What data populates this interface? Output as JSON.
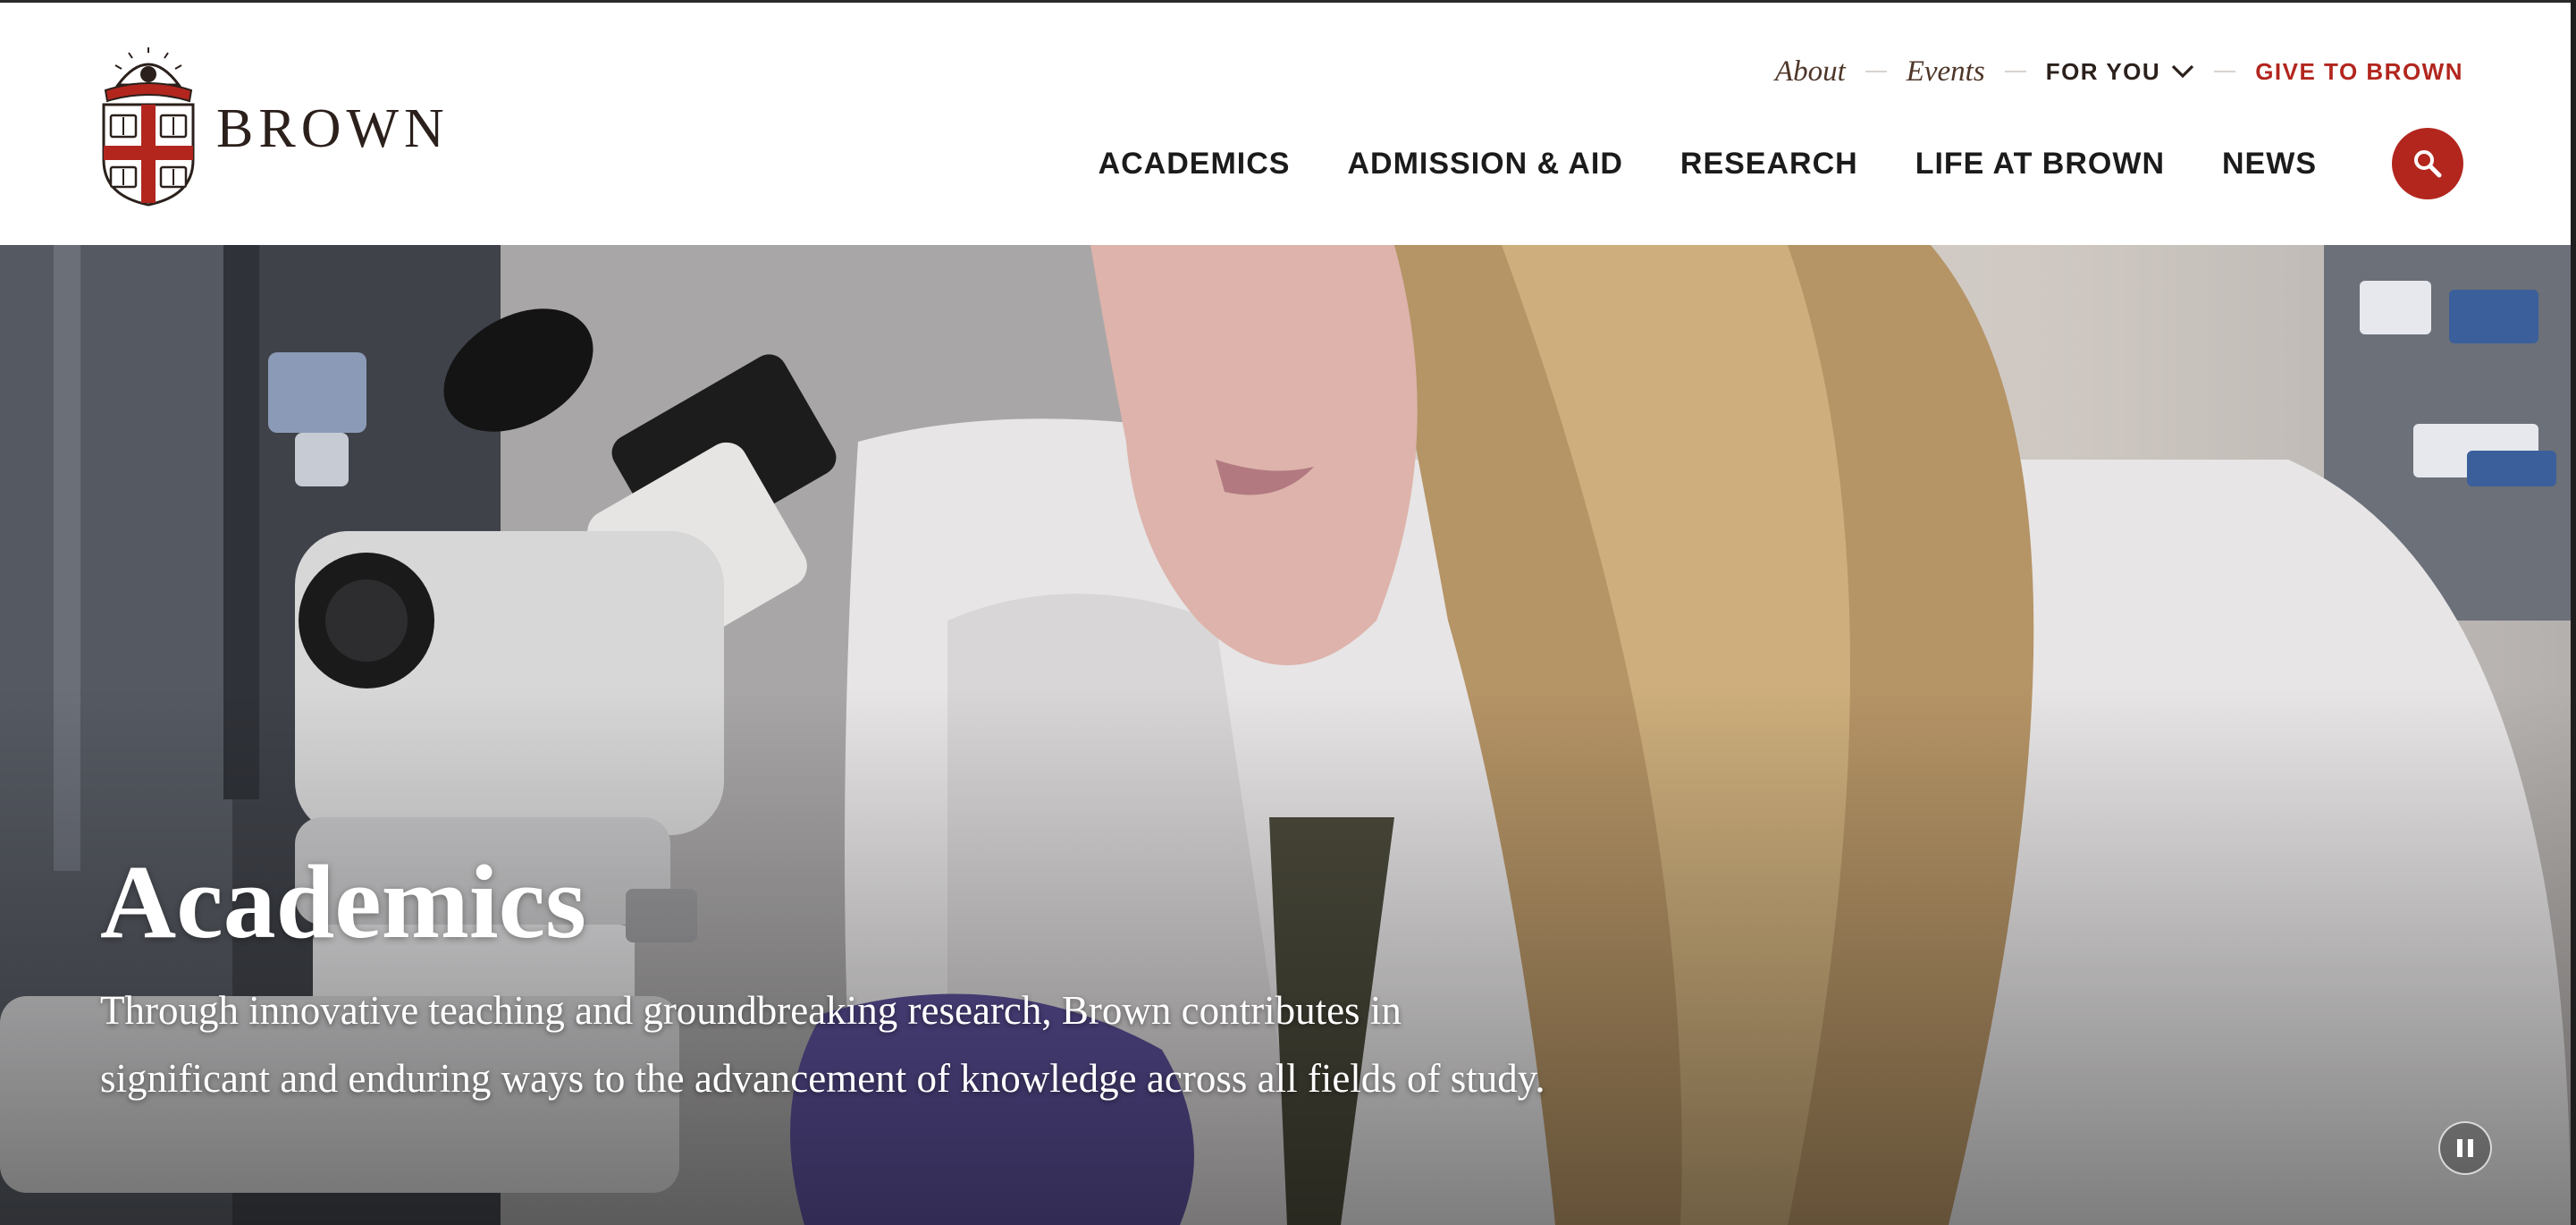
{
  "brand": {
    "name": "BROWN",
    "logo_icon": "brown-shield-logo-icon",
    "colors": {
      "brand_red": "#b2261e",
      "brand_brown": "#4e3629",
      "text_dark": "#1b1b1b"
    }
  },
  "utility_nav": {
    "items": [
      {
        "label": "About"
      },
      {
        "label": "Events"
      }
    ],
    "for_you": {
      "label": "FOR YOU",
      "icon": "chevron-down-icon"
    },
    "give": {
      "label": "GIVE TO BROWN"
    }
  },
  "main_nav": {
    "items": [
      {
        "label": "ACADEMICS"
      },
      {
        "label": "ADMISSION & AID"
      },
      {
        "label": "RESEARCH"
      },
      {
        "label": "LIFE AT BROWN"
      },
      {
        "label": "NEWS"
      }
    ],
    "search_icon": "search-icon"
  },
  "hero": {
    "image_subject": "researcher-at-microscope",
    "title": "Academics",
    "description": "Through innovative teaching and groundbreaking research, Brown contributes in significant and enduring ways to the advancement of knowledge across all fields of study.",
    "pause_icon": "pause-icon"
  }
}
